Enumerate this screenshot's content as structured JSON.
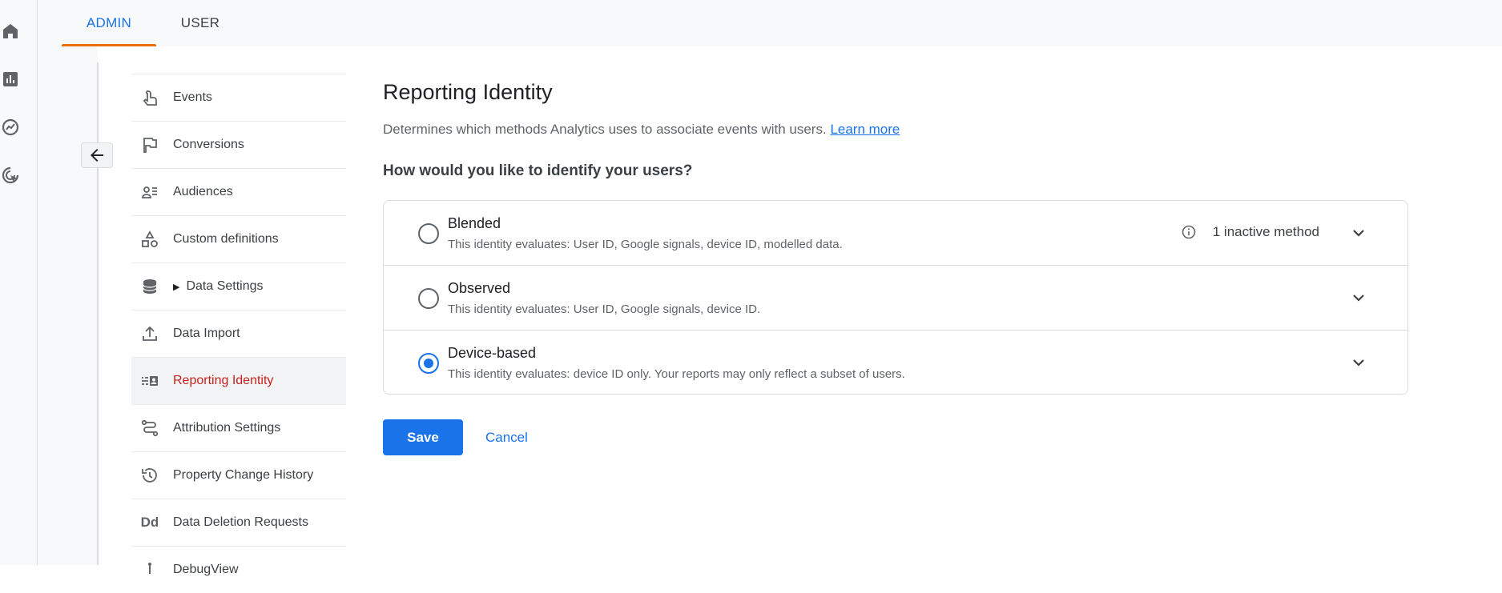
{
  "tabs": [
    {
      "label": "ADMIN",
      "active": true
    },
    {
      "label": "USER",
      "active": false
    }
  ],
  "rail": {
    "icons": [
      "home-icon",
      "reports-icon",
      "explore-icon",
      "advertising-icon"
    ]
  },
  "nav": {
    "items": [
      {
        "label": "Events",
        "icon": "touch-icon"
      },
      {
        "label": "Conversions",
        "icon": "flag-icon"
      },
      {
        "label": "Audiences",
        "icon": "audience-icon"
      },
      {
        "label": "Custom definitions",
        "icon": "shapes-icon"
      },
      {
        "label": "Data Settings",
        "icon": "database-icon"
      },
      {
        "label": "Data Import",
        "icon": "upload-icon"
      },
      {
        "label": "Reporting Identity",
        "icon": "identity-icon",
        "active": true
      },
      {
        "label": "Attribution Settings",
        "icon": "route-icon"
      },
      {
        "label": "Property Change History",
        "icon": "history-icon"
      },
      {
        "label": "Data Deletion Requests",
        "icon": "Dd"
      },
      {
        "label": "DebugView",
        "icon": "debug-icon"
      }
    ]
  },
  "main": {
    "title": "Reporting Identity",
    "description": "Determines which methods Analytics uses to associate events with users.",
    "learn_more": "Learn more",
    "question": "How would you like to identify your users?",
    "options": [
      {
        "title": "Blended",
        "subtitle": "This identity evaluates: User ID, Google signals, device ID, modelled data.",
        "selected": false,
        "inactive_note": "1 inactive method"
      },
      {
        "title": "Observed",
        "subtitle": "This identity evaluates: User ID, Google signals, device ID.",
        "selected": false
      },
      {
        "title": "Device-based",
        "subtitle": "This identity evaluates: device ID only. Your reports may only reflect a subset of users.",
        "selected": true
      }
    ],
    "save_label": "Save",
    "cancel_label": "Cancel"
  },
  "colors": {
    "accent": "#1a73e8",
    "active_nav_text": "#c5221f",
    "tab_indicator": "#e8710a"
  }
}
